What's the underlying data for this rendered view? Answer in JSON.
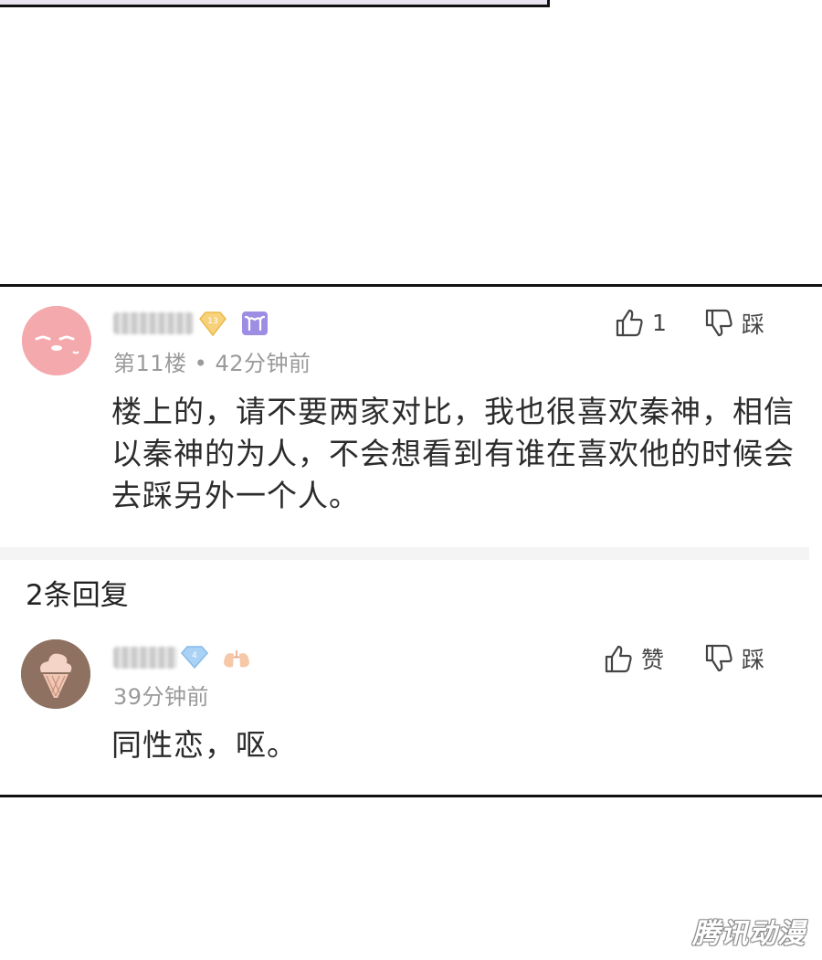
{
  "top_comment": {
    "level_badge": "13",
    "meta": "第11楼 • 42分钟前",
    "text": "楼上的，请不要两家对比，我也很喜欢秦神，相信以秦神的为人，不会想看到有谁在喜欢他的时候会去踩另外一个人。",
    "like_label": "1",
    "dislike_label": "踩"
  },
  "replies_header": "2条回复",
  "reply": {
    "level_badge": "4",
    "meta": "39分钟前",
    "text": "同性恋，呕。",
    "like_label": "赞",
    "dislike_label": "踩"
  },
  "watermark": "腾讯动漫",
  "icons": {
    "like": "thumbs-up-icon",
    "dislike": "thumbs-down-icon",
    "gold_badge": "gold-diamond-icon",
    "blue_badge": "blue-diamond-icon",
    "aries": "aries-zodiac-icon",
    "heart": "lungs-heart-icon"
  },
  "colors": {
    "avatar1": "#f4a9ad",
    "avatar2": "#8f7161",
    "meta_gray": "#9a9a9a",
    "panel_border": "#111111"
  }
}
